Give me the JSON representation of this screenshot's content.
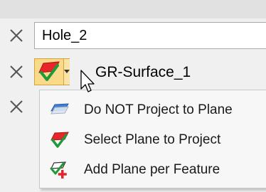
{
  "rows": [
    {
      "remove_icon": "close-x-icon",
      "value": "Hole_2"
    },
    {
      "remove_icon": "close-x-icon",
      "plane_icon": "select-plane-checkmark-icon",
      "dropdown_icon": "dropdown-arrow-icon",
      "label": "GR-Surface_1"
    },
    {
      "remove_icon": "close-x-icon"
    }
  ],
  "menu": {
    "items": [
      {
        "icon": "no-project-plane-icon",
        "label": "Do NOT Project to Plane"
      },
      {
        "icon": "select-plane-checkmark-icon",
        "label": "Select Plane to Project"
      },
      {
        "icon": "add-plane-plus-icon",
        "label": "Add Plane per Feature"
      }
    ]
  },
  "colors": {
    "selected_button_bg": "#fbd98b",
    "selected_button_border": "#d4a43c",
    "plane_red": "#e8262a",
    "plane_blue": "#3c7fd6",
    "check_green": "#1f9a3a",
    "plus_red": "#e0262a"
  }
}
